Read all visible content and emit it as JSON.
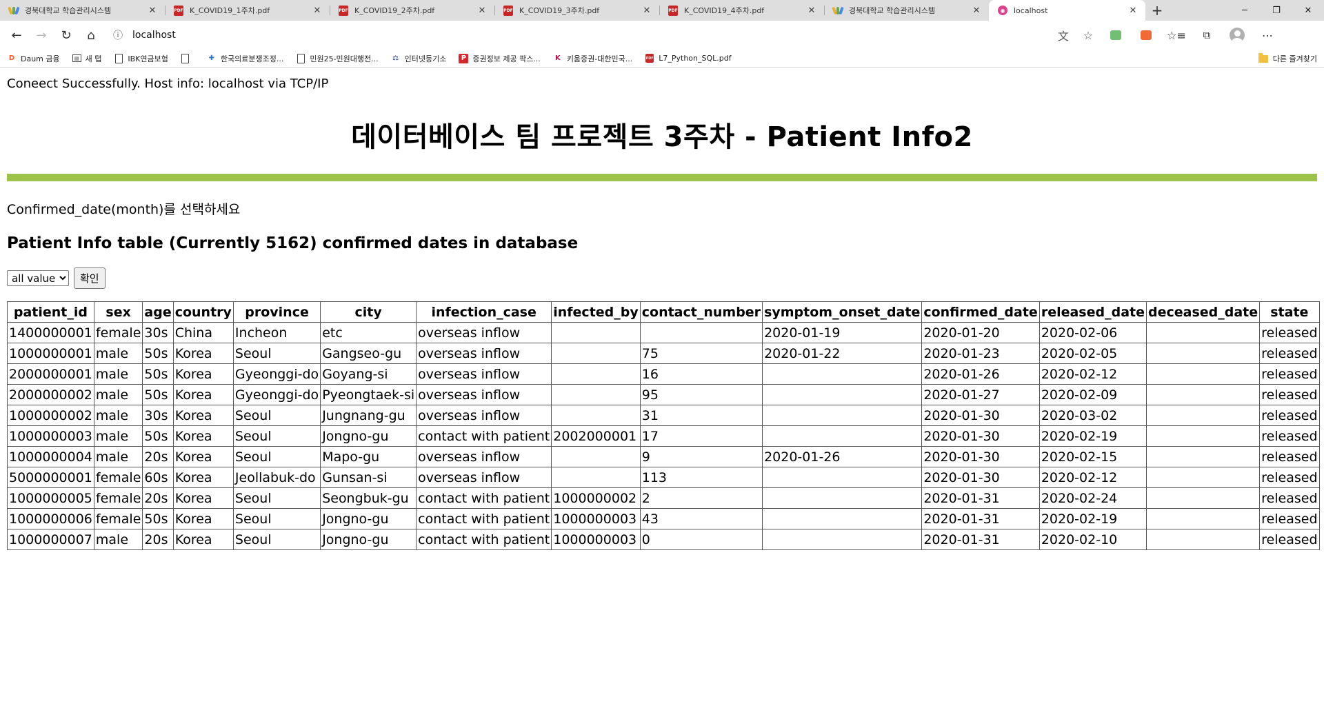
{
  "browser": {
    "tabs": [
      {
        "title": "경북대학교 학습관리시스템",
        "icon": "lms-icon"
      },
      {
        "title": "K_COVID19_1주차.pdf",
        "icon": "pdf-icon"
      },
      {
        "title": "K_COVID19_2주차.pdf",
        "icon": "pdf-icon"
      },
      {
        "title": "K_COVID19_3주차.pdf",
        "icon": "pdf-icon"
      },
      {
        "title": "K_COVID19_4주차.pdf",
        "icon": "pdf-icon"
      },
      {
        "title": "경북대학교 학습관리시스템",
        "icon": "lms-icon"
      },
      {
        "title": "localhost",
        "icon": "localhost-icon",
        "active": true
      }
    ],
    "address": "localhost",
    "bookmarks": [
      {
        "label": "Daum 금융"
      },
      {
        "label": "새 탭"
      },
      {
        "label": "IBK연금보험"
      },
      {
        "label": ""
      },
      {
        "label": "한국의료분쟁조정..."
      },
      {
        "label": "민원25-민원대행전..."
      },
      {
        "label": "인터넷등기소"
      },
      {
        "label": "증권정보 제공 팍스..."
      },
      {
        "label": "키움증권-대한민국..."
      },
      {
        "label": "L7_Python_SQL.pdf"
      }
    ],
    "other_favorites": "다른 즐겨찾기",
    "accent_color": "#9dc24a"
  },
  "page": {
    "connect_message": "Coneect Successfully. Host info: localhost via TCP/IP",
    "title": "데이터베이스 팀 프로젝트 3주차 - Patient Info2",
    "prompt": "Confirmed_date(month)를 선택하세요",
    "subtitle": "Patient Info table (Currently 5162) confirmed dates in database",
    "select_value": "all value",
    "confirm_button": "확인"
  },
  "table": {
    "headers": [
      "patient_id",
      "sex",
      "age",
      "country",
      "province",
      "city",
      "infection_case",
      "infected_by",
      "contact_number",
      "symptom_onset_date",
      "confirmed_date",
      "released_date",
      "deceased_date",
      "state"
    ],
    "rows": [
      [
        "1400000001",
        "female",
        "30s",
        "China",
        "Incheon",
        "etc",
        "overseas inflow",
        "",
        "",
        "2020-01-19",
        "2020-01-20",
        "2020-02-06",
        "",
        "released"
      ],
      [
        "1000000001",
        "male",
        "50s",
        "Korea",
        "Seoul",
        "Gangseo-gu",
        "overseas inflow",
        "",
        "75",
        "2020-01-22",
        "2020-01-23",
        "2020-02-05",
        "",
        "released"
      ],
      [
        "2000000001",
        "male",
        "50s",
        "Korea",
        "Gyeonggi-do",
        "Goyang-si",
        "overseas inflow",
        "",
        "16",
        "",
        "2020-01-26",
        "2020-02-12",
        "",
        "released"
      ],
      [
        "2000000002",
        "male",
        "50s",
        "Korea",
        "Gyeonggi-do",
        "Pyeongtaek-si",
        "overseas inflow",
        "",
        "95",
        "",
        "2020-01-27",
        "2020-02-09",
        "",
        "released"
      ],
      [
        "1000000002",
        "male",
        "30s",
        "Korea",
        "Seoul",
        "Jungnang-gu",
        "overseas inflow",
        "",
        "31",
        "",
        "2020-01-30",
        "2020-03-02",
        "",
        "released"
      ],
      [
        "1000000003",
        "male",
        "50s",
        "Korea",
        "Seoul",
        "Jongno-gu",
        "contact with patient",
        "2002000001",
        "17",
        "",
        "2020-01-30",
        "2020-02-19",
        "",
        "released"
      ],
      [
        "1000000004",
        "male",
        "20s",
        "Korea",
        "Seoul",
        "Mapo-gu",
        "overseas inflow",
        "",
        "9",
        "2020-01-26",
        "2020-01-30",
        "2020-02-15",
        "",
        "released"
      ],
      [
        "5000000001",
        "female",
        "60s",
        "Korea",
        "Jeollabuk-do",
        "Gunsan-si",
        "overseas inflow",
        "",
        "113",
        "",
        "2020-01-30",
        "2020-02-12",
        "",
        "released"
      ],
      [
        "1000000005",
        "female",
        "20s",
        "Korea",
        "Seoul",
        "Seongbuk-gu",
        "contact with patient",
        "1000000002",
        "2",
        "",
        "2020-01-31",
        "2020-02-24",
        "",
        "released"
      ],
      [
        "1000000006",
        "female",
        "50s",
        "Korea",
        "Seoul",
        "Jongno-gu",
        "contact with patient",
        "1000000003",
        "43",
        "",
        "2020-01-31",
        "2020-02-19",
        "",
        "released"
      ],
      [
        "1000000007",
        "male",
        "20s",
        "Korea",
        "Seoul",
        "Jongno-gu",
        "contact with patient",
        "1000000003",
        "0",
        "",
        "2020-01-31",
        "2020-02-10",
        "",
        "released"
      ]
    ]
  }
}
